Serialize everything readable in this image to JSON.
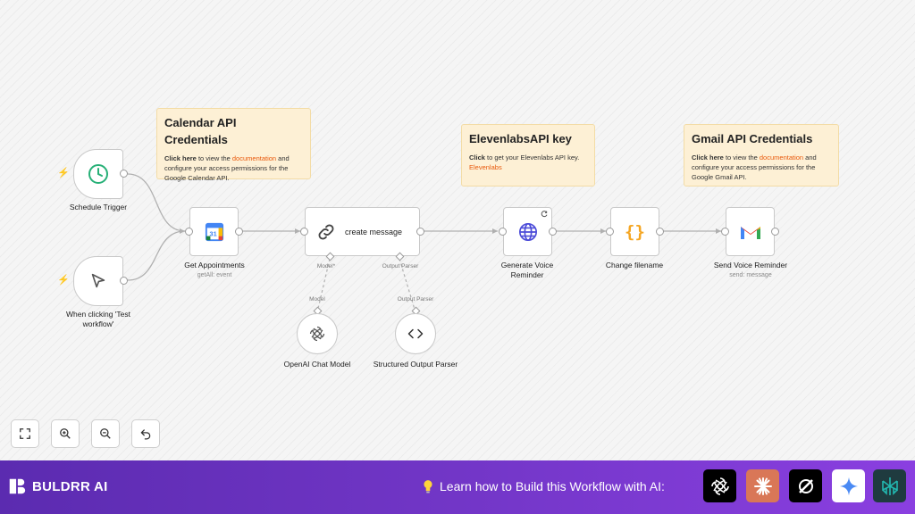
{
  "notes": {
    "calendar": {
      "title": "Calendar API Credentials",
      "click": "Click here",
      "text1": " to view the ",
      "link": "documentation",
      "text2": " and configure your access permissions for the Google Calendar API."
    },
    "elevenlabs": {
      "title": "ElevenlabsAPI key",
      "click": "Click",
      "text1": " to get your Elevenlabs API key. ",
      "link": "Elevenlabs"
    },
    "gmail": {
      "title": "Gmail API Credentials",
      "click": "Click here",
      "text1": " to view the ",
      "link": "documentation",
      "text2": " and configure your access permissions for the Google Gmail API."
    }
  },
  "nodes": {
    "schedule_trigger": {
      "label": "Schedule Trigger",
      "icon": "clock-icon"
    },
    "manual_trigger": {
      "label": "When clicking 'Test workflow'",
      "icon": "cursor-icon"
    },
    "get_appointments": {
      "label": "Get Appointments",
      "sublabel": "getAll: event",
      "icon": "google-calendar-icon"
    },
    "create_message": {
      "label": "create message",
      "icon": "link-icon",
      "port_model": "Model*",
      "port_parser": "Output Parser"
    },
    "openai_chat_model": {
      "label": "OpenAI Chat Model",
      "connector": "Model",
      "icon": "openai-icon"
    },
    "structured_output_parser": {
      "label": "Structured Output Parser",
      "connector": "Output Parser",
      "icon": "code-icon"
    },
    "generate_voice": {
      "label": "Generate Voice Reminder",
      "icon": "globe-icon"
    },
    "change_filename": {
      "label": "Change filename",
      "icon": "braces-icon"
    },
    "send_voice": {
      "label": "Send Voice Reminder",
      "sublabel": "send: message",
      "icon": "gmail-icon"
    }
  },
  "controls": {
    "fit": "fit-view-icon",
    "zoom_in": "zoom-in-icon",
    "zoom_out": "zoom-out-icon",
    "reset": "undo-icon"
  },
  "footer": {
    "brand": "BULDRR AI",
    "cta": "Learn how to Build this Workflow with AI:",
    "ai_tools": [
      "chatgpt-icon",
      "claude-icon",
      "perplexity-style-icon",
      "gemini-icon",
      "perplexity-icon"
    ]
  },
  "colors": {
    "accent": "#ff6d5a",
    "footer_start": "#5b2bb0",
    "footer_end": "#8a3fe0",
    "note_bg": "#fdf0d5",
    "clock_green": "#27b077"
  }
}
